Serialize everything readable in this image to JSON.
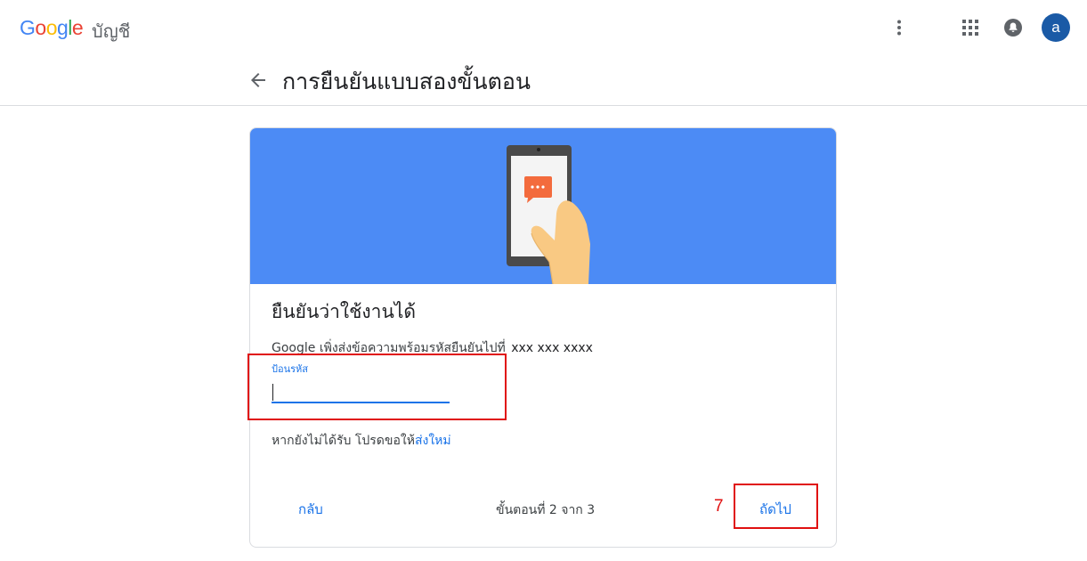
{
  "header": {
    "logo_text": "Google",
    "account_label": "บัญชี",
    "avatar_letter": "a",
    "icons": [
      "more-vert-icon",
      "apps-grid-icon",
      "notification-bell-icon"
    ]
  },
  "title_bar": {
    "title": "การยืนยันแบบสองขั้นตอน"
  },
  "card": {
    "heading": "ยืนยันว่าใช้งานได้",
    "description": "Google เพิ่งส่งข้อความพร้อมรหัสยืนยันไปที่",
    "phone": "xxx  xxx  xxxx",
    "code_label": "ป้อนรหัส",
    "code_value": "",
    "resend_text": "หากยังไม่ได้รับ โปรดขอให้",
    "resend_link": "ส่งใหม่",
    "back_label": "กลับ",
    "step_text": "ขั้นตอนที่ 2 จาก 3",
    "next_label": "ถัดไป"
  },
  "annotation": {
    "step_number": "7",
    "color": "#e01010"
  },
  "colors": {
    "banner": "#4c8bf5",
    "accent": "#1a73e8",
    "avatar": "#1a5aa6"
  }
}
